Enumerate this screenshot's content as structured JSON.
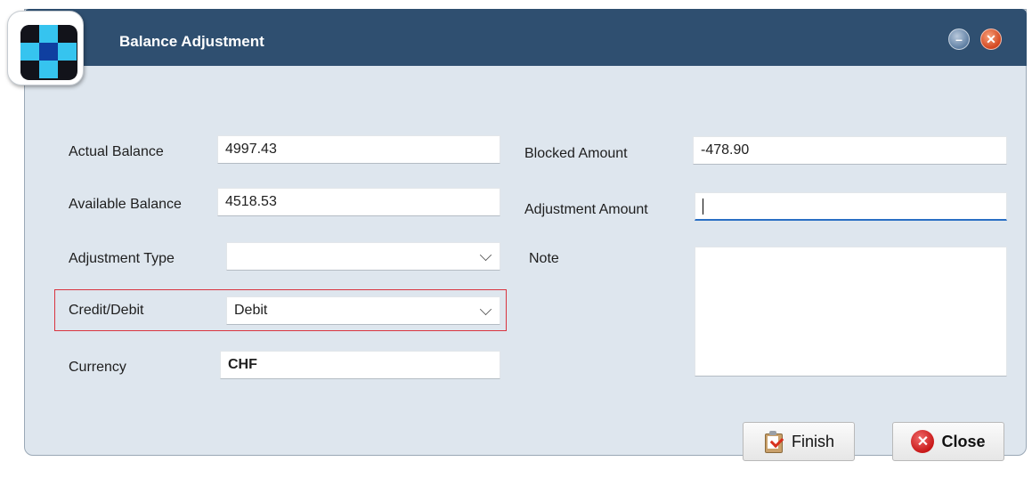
{
  "window": {
    "title": "Balance Adjustment",
    "minimize_glyph": "–",
    "close_glyph": "✕"
  },
  "form": {
    "actual_balance": {
      "label": "Actual Balance",
      "value": "4997.43"
    },
    "available_balance": {
      "label": "Available Balance",
      "value": "4518.53"
    },
    "adjustment_type": {
      "label": "Adjustment Type",
      "value": ""
    },
    "credit_debit": {
      "label": "Credit/Debit",
      "value": "Debit"
    },
    "currency": {
      "label": "Currency",
      "value": "CHF"
    },
    "blocked_amount": {
      "label": "Blocked Amount",
      "value": "-478.90"
    },
    "adjustment_amount": {
      "label": "Adjustment Amount",
      "value": ""
    },
    "note": {
      "label": "Note",
      "value": ""
    }
  },
  "buttons": {
    "finish": "Finish",
    "close": "Close",
    "close_glyph": "✕"
  },
  "icons": {
    "app": "app-grid-icon",
    "finish": "clipboard-check-icon",
    "close": "close-circle-icon"
  },
  "colors": {
    "titlebar": "#2f4f70",
    "window_bg": "#dee6ee",
    "highlight": "#d9343f",
    "focus": "#2a6fc4"
  }
}
